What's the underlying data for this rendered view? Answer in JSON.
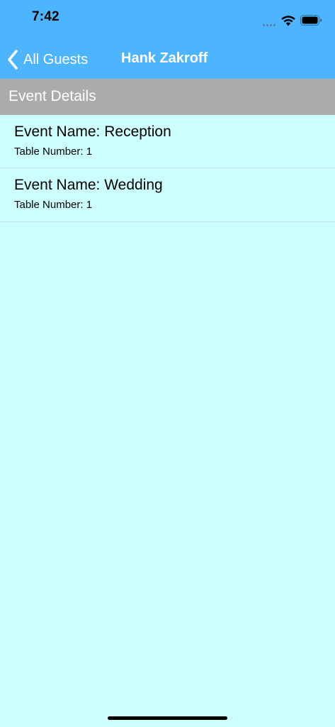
{
  "status_bar": {
    "time": "7:42",
    "icons": [
      "cellular-signal-icon",
      "wifi-icon",
      "battery-icon"
    ]
  },
  "nav_bar": {
    "back_label": "All Guests",
    "back_icon": "chevron-left-icon",
    "title": "Hank Zakroff"
  },
  "section": {
    "header": "Event Details"
  },
  "events": [
    {
      "name": "Event Name: Reception",
      "table": "Table Number: 1"
    },
    {
      "name": "Event Name: Wedding",
      "table": "Table Number: 1"
    }
  ],
  "colors": {
    "nav_background": "#4DB5FF",
    "section_header_background": "#ABABAB",
    "content_background": "#CCFFFF",
    "nav_text": "#FFFFFF"
  }
}
